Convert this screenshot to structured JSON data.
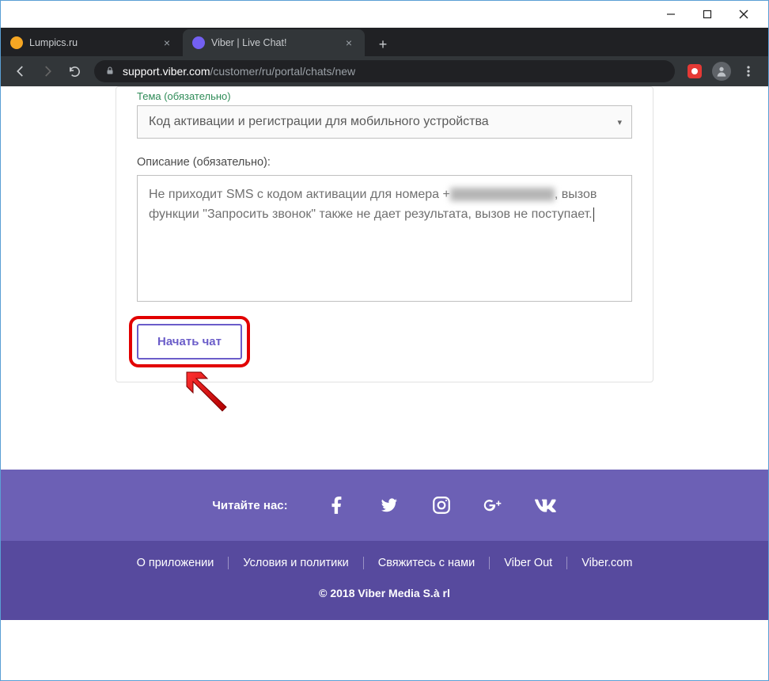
{
  "tabs": [
    {
      "title": "Lumpics.ru",
      "icon_color": "#f5a623"
    },
    {
      "title": "Viber | Live Chat!",
      "icon_color": "#7360f2"
    }
  ],
  "url": {
    "domain": "support.viber.com",
    "path": "/customer/ru/portal/chats/new"
  },
  "form": {
    "topic_label": "Тема (обязательно)",
    "topic_value": "Код активации и регистрации для мобильного устройства",
    "desc_label": "Описание (обязательно):",
    "desc_value_pre": "Не приходит SMS с кодом активации для номера +",
    "desc_value_post": ", вызов функции \"Запросить звонок\" также не дает результата, вызов не поступает.",
    "submit_label": "Начать чат"
  },
  "footer": {
    "social_label": "Читайте нас:",
    "links": [
      "О приложении",
      "Условия и политики",
      "Свяжитесь с нами",
      "Viber Out",
      "Viber.com"
    ],
    "copyright": "© 2018 Viber Media S.à rl"
  }
}
